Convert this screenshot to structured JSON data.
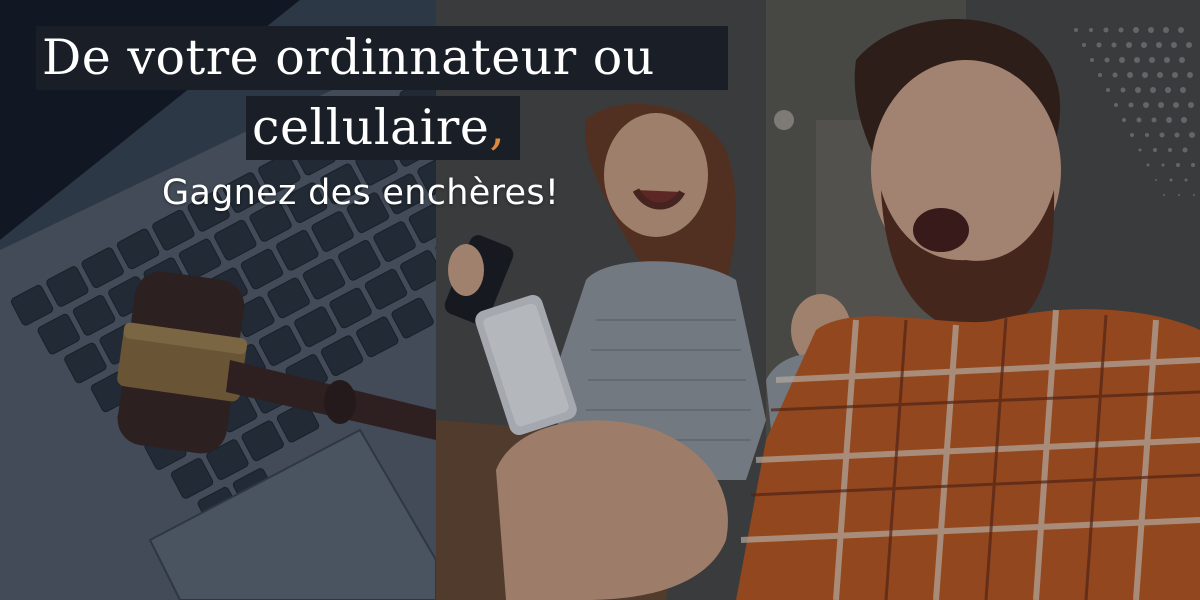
{
  "headline": {
    "line1": "De votre ordinnateur ou",
    "line2": "cellulaire",
    "line2_punctuation": ",",
    "subline": "Gagnez des enchères!"
  },
  "colors": {
    "headline_bg": "#1a1f27",
    "headline_text": "#ffffff",
    "comma_accent": "#d98a3a",
    "shirt_orange": "#c75a1e"
  },
  "images": {
    "left": "laptop-with-gavel-photo",
    "right": "excited-couple-with-phones-photo"
  }
}
